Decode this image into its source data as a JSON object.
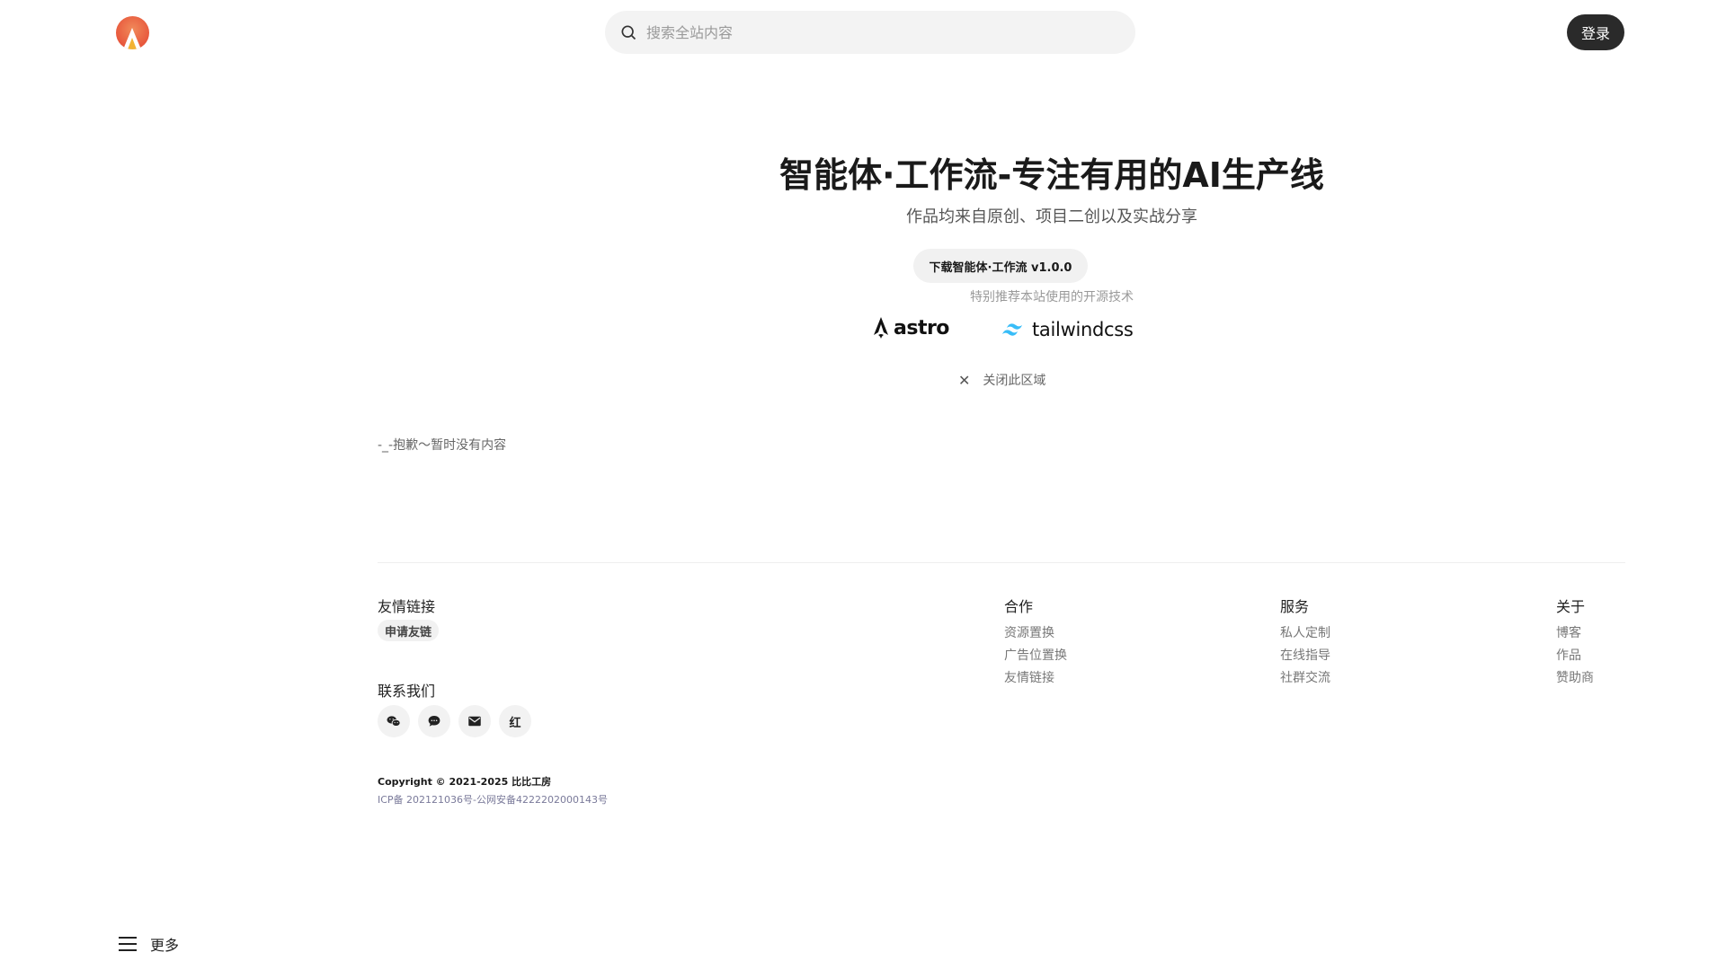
{
  "header": {
    "logo_icon": "app-logo-icon",
    "search_placeholder": "搜索全站内容",
    "login_label": "登录"
  },
  "hero": {
    "title": "智能体·工作流-专注有用的AI生产线",
    "subtitle": "作品均来自原创、项目二创以及实战分享",
    "download_label": "下载智能体·工作流 v1.0.0",
    "recommend_text": "特别推荐本站使用的开源技术",
    "brands": [
      {
        "name": "astro",
        "icon": "astro-logo-icon"
      },
      {
        "name": "tailwindcss",
        "icon": "tailwind-logo-icon"
      }
    ],
    "close_label": "关闭此区域"
  },
  "main": {
    "empty_message": "-_-抱歉～暂时没有内容"
  },
  "footer": {
    "friends_heading": "友情链接",
    "apply_friend_label": "申请友链",
    "contact_heading": "联系我们",
    "social_icons": [
      "wechat-icon",
      "chat-bubble-icon",
      "mail-icon",
      "xiaohongshu-icon"
    ],
    "xhs_text": "红",
    "columns": [
      {
        "heading": "合作",
        "links": [
          "资源置换",
          "广告位置换",
          "友情链接"
        ]
      },
      {
        "heading": "服务",
        "links": [
          "私人定制",
          "在线指导",
          "社群交流"
        ]
      },
      {
        "heading": "关于",
        "links": [
          "博客",
          "作品",
          "赞助商"
        ]
      }
    ],
    "copyright": "Copyright © 2021-2025 比比工房",
    "icp": "ICP备 202121036号-公网安备4222202000143号"
  },
  "bottom": {
    "more_label": "更多",
    "menu_icon": "menu-icon"
  },
  "colors": {
    "accent": "#e8573c",
    "button_dark": "#2a2a2a",
    "tailwind": "#38bdf8"
  }
}
